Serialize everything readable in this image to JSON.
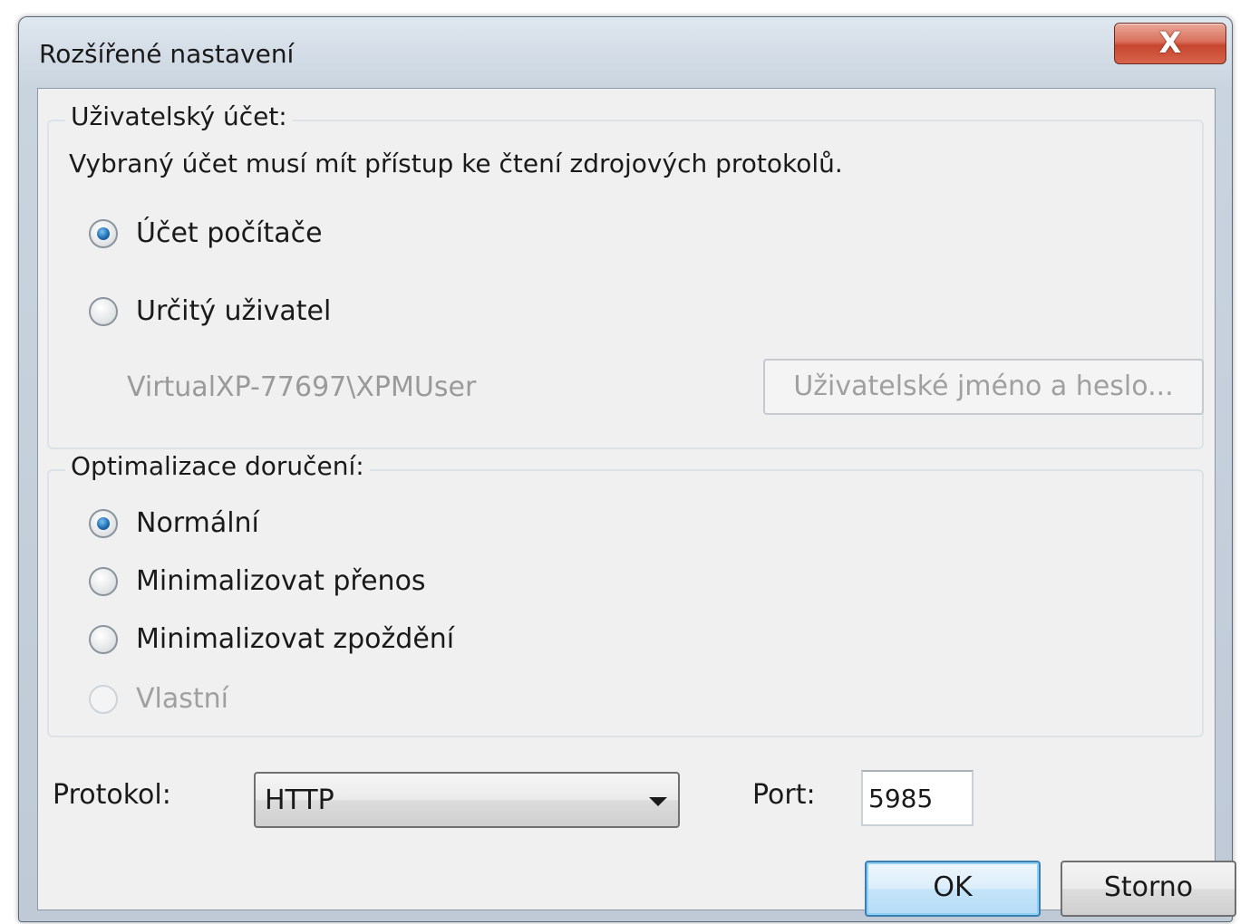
{
  "window": {
    "title": "Rozšířené nastavení",
    "close_glyph": "X"
  },
  "user_account": {
    "legend": "Uživatelský účet:",
    "description": "Vybraný účet musí mít přístup ke čtení zdrojových protokolů.",
    "options": [
      {
        "label": "Účet počítače",
        "checked": true,
        "disabled": false
      },
      {
        "label": "Určitý uživatel",
        "checked": false,
        "disabled": false
      }
    ],
    "user_value": "VirtualXP-77697\\XPMUser",
    "credentials_button": "Uživatelské jméno a heslo..."
  },
  "delivery": {
    "legend": "Optimalizace doručení:",
    "options": [
      {
        "label": "Normální",
        "checked": true,
        "disabled": false
      },
      {
        "label": "Minimalizovat přenos",
        "checked": false,
        "disabled": false
      },
      {
        "label": "Minimalizovat zpoždění",
        "checked": false,
        "disabled": false
      },
      {
        "label": "Vlastní",
        "checked": false,
        "disabled": true
      }
    ]
  },
  "protocol": {
    "label": "Protokol:",
    "selected": "HTTP"
  },
  "port": {
    "label": "Port:",
    "value": "5985"
  },
  "buttons": {
    "ok": "OK",
    "cancel": "Storno"
  },
  "colors": {
    "accent": "#3c7fb1",
    "close_red": "#c7462d",
    "dialog_bg": "#f0f0f0"
  }
}
